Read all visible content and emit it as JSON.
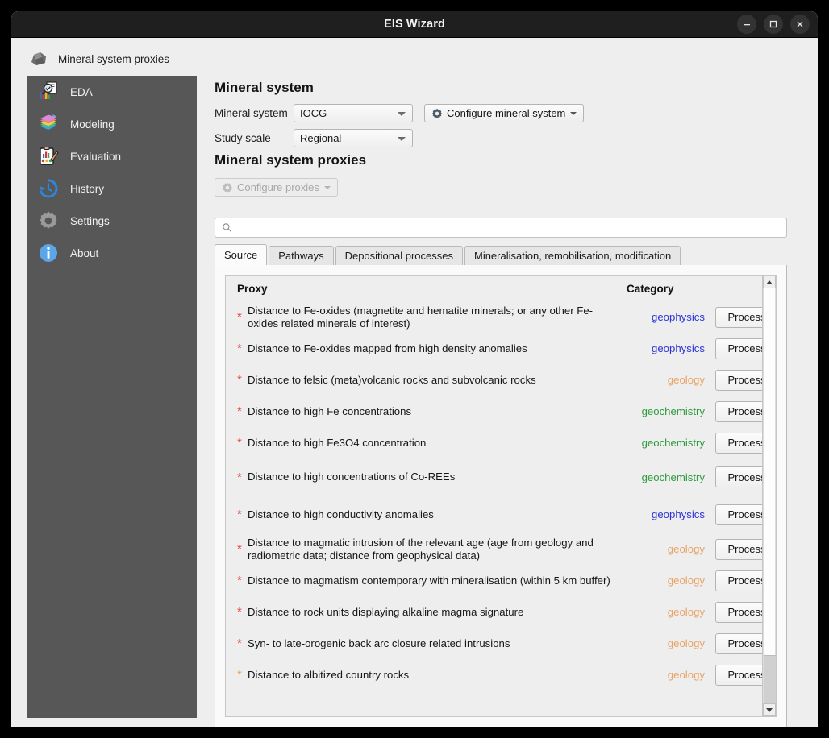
{
  "window": {
    "title": "EIS Wizard",
    "controls": [
      {
        "name": "minimize-button",
        "glyph": "minimize-icon"
      },
      {
        "name": "maximize-button",
        "glyph": "maximize-icon"
      },
      {
        "name": "close-button",
        "glyph": "close-icon"
      }
    ]
  },
  "sidebar": {
    "header": {
      "label": "Mineral system proxies",
      "icon": "rock-icon"
    },
    "items": [
      {
        "label": "EDA",
        "icon": "eda-icon"
      },
      {
        "label": "Modeling",
        "icon": "modeling-icon"
      },
      {
        "label": "Evaluation",
        "icon": "evaluation-icon"
      },
      {
        "label": "History",
        "icon": "history-clock-icon"
      },
      {
        "label": "Settings",
        "icon": "gear-icon"
      },
      {
        "label": "About",
        "icon": "info-icon"
      }
    ]
  },
  "main": {
    "mineral_system": {
      "heading": "Mineral system",
      "fields": [
        {
          "label": "Mineral system",
          "value": "IOCG"
        },
        {
          "label": "Study scale",
          "value": "Regional"
        }
      ],
      "configure_button": "Configure mineral system"
    },
    "proxies": {
      "heading": "Mineral system proxies",
      "configure_button": "Configure proxies",
      "configure_button_disabled": true,
      "search": {
        "value": "",
        "placeholder": ""
      },
      "tabs": [
        {
          "label": "Source",
          "active": true
        },
        {
          "label": "Pathways",
          "active": false
        },
        {
          "label": "Depositional processes",
          "active": false
        },
        {
          "label": "Mineralisation, remobilisation, modification",
          "active": false
        }
      ],
      "table": {
        "columns": [
          "Proxy",
          "Category"
        ],
        "action_label": "Process",
        "rows": [
          {
            "marker": "required",
            "proxy": "Distance to Fe-oxides (magnetite and hematite minerals; or any other Fe-oxides related minerals of interest)",
            "category": "geophysics"
          },
          {
            "marker": "required",
            "proxy": "Distance to Fe-oxides mapped from high density anomalies",
            "category": "geophysics"
          },
          {
            "marker": "required",
            "proxy": "Distance to felsic (meta)volcanic rocks and subvolcanic rocks",
            "category": "geology"
          },
          {
            "marker": "required",
            "proxy": "Distance to high Fe concentrations",
            "category": "geochemistry"
          },
          {
            "marker": "required",
            "proxy": "Distance to high Fe3O4 concentration",
            "category": "geochemistry"
          },
          {
            "marker": "required",
            "proxy": "Distance to high concentrations of Co-REEs",
            "category": "geochemistry"
          },
          {
            "marker": "required",
            "proxy": "Distance to high conductivity anomalies",
            "category": "geophysics"
          },
          {
            "marker": "required",
            "proxy": "Distance to magmatic intrusion of the relevant age (age from geology and radiometric data; distance from geophysical data)",
            "category": "geology"
          },
          {
            "marker": "required",
            "proxy": "Distance to magmatism contemporary with mineralisation (within 5 km buffer)",
            "category": "geology"
          },
          {
            "marker": "required",
            "proxy": "Distance to rock units displaying alkaline magma signature",
            "category": "geology"
          },
          {
            "marker": "required",
            "proxy": "Syn- to late-orogenic back arc closure related intrusions",
            "category": "geology"
          },
          {
            "marker": "optional",
            "proxy": "Distance to albitized country rocks",
            "category": "geology"
          }
        ]
      },
      "scrollbar": {
        "position": "near-bottom"
      }
    }
  },
  "colors": {
    "titlebar": "#1f1f1f",
    "sidebar": "#575757",
    "page": "#eeeeee",
    "geophysics": "#2b33d8",
    "geology": "#e8a465",
    "geochemistry": "#2f9b3f",
    "required_marker": "#e8463f",
    "optional_marker": "#e8a33d"
  }
}
